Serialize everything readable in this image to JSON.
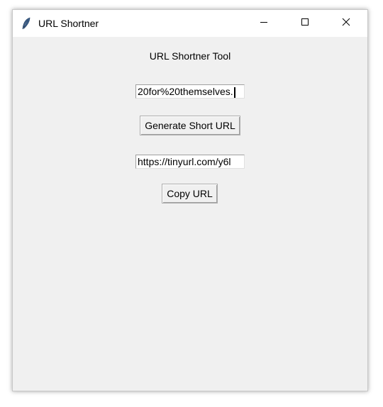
{
  "window": {
    "title": "URL Shortner",
    "icon": "feather-icon"
  },
  "controls": {
    "minimize_icon": "minimize-icon",
    "maximize_icon": "maximize-icon",
    "close_icon": "close-icon"
  },
  "main": {
    "heading": "URL Shortner Tool",
    "long_url_value": "20for%20themselves.",
    "generate_label": "Generate Short URL",
    "short_url_value": "https://tinyurl.com/y6l",
    "copy_label": "Copy URL"
  }
}
